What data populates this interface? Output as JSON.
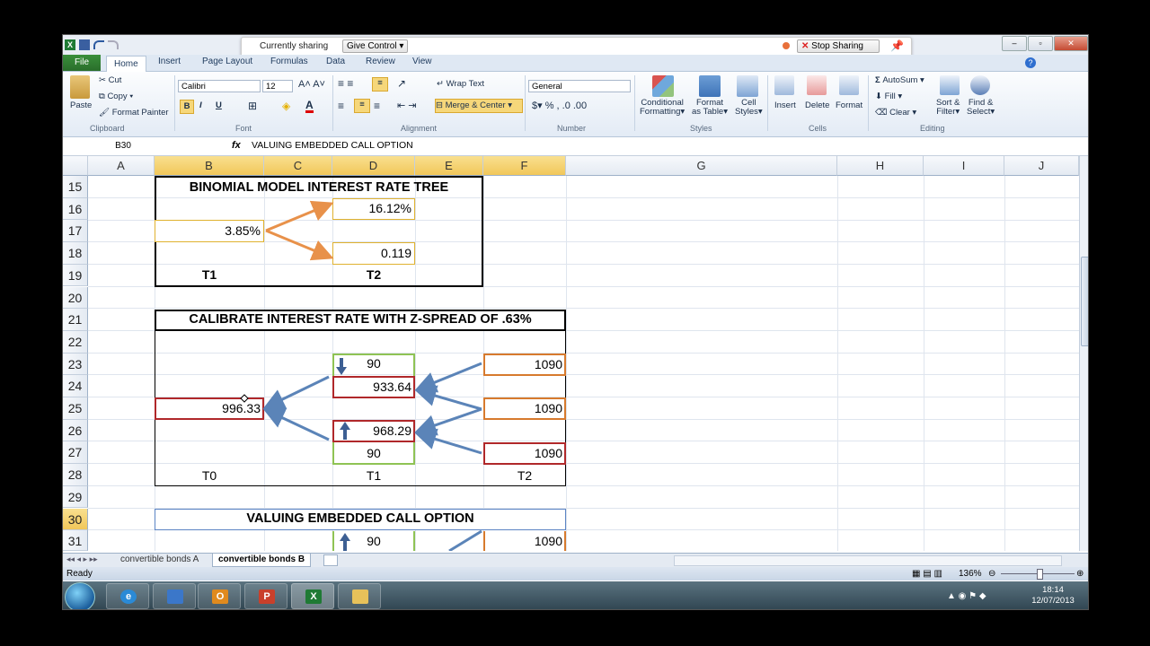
{
  "share_bar": {
    "status": "Currently sharing",
    "give_control": "Give Control",
    "stop": "Stop Sharing"
  },
  "tabs": [
    "File",
    "Home",
    "Insert",
    "Page Layout",
    "Formulas",
    "Data",
    "Review",
    "View"
  ],
  "ribbon": {
    "clipboard": {
      "paste": "Paste",
      "cut": "Cut",
      "copy": "Copy",
      "format_painter": "Format Painter",
      "label": "Clipboard"
    },
    "font": {
      "name": "Calibri",
      "size": "12",
      "label": "Font"
    },
    "alignment": {
      "wrap": "Wrap Text",
      "merge": "Merge & Center",
      "label": "Alignment"
    },
    "number": {
      "format": "General",
      "label": "Number"
    },
    "styles": {
      "cond": "Conditional",
      "cond2": "Formatting",
      "table": "Format",
      "table2": "as Table",
      "cell": "Cell",
      "cell2": "Styles",
      "label": "Styles"
    },
    "cells": {
      "insert": "Insert",
      "delete": "Delete",
      "format": "Format",
      "label": "Cells"
    },
    "editing": {
      "autosum": "AutoSum",
      "fill": "Fill",
      "clear": "Clear",
      "sort": "Sort &",
      "sort2": "Filter",
      "find": "Find &",
      "find2": "Select",
      "label": "Editing"
    }
  },
  "formula_bar": {
    "name_box": "B30",
    "value": "VALUING EMBEDDED CALL OPTION"
  },
  "columns": [
    "A",
    "B",
    "C",
    "D",
    "E",
    "F",
    "G",
    "H",
    "I",
    "J"
  ],
  "rows": [
    "15",
    "16",
    "17",
    "18",
    "19",
    "20",
    "21",
    "22",
    "23",
    "24",
    "25",
    "26",
    "27",
    "28",
    "29",
    "30",
    "31"
  ],
  "tree1": {
    "title": "BINOMIAL MODEL INTEREST RATE TREE",
    "t0": "3.85%",
    "up": "16.12%",
    "down": "0.119",
    "l1": "T1",
    "l2": "T2"
  },
  "tree2": {
    "title": "CALIBRATE INTEREST RATE WITH Z-SPREAD OF .63%",
    "coupon_up": "90",
    "val_up": "933.64",
    "val_down": "968.29",
    "coupon_down": "90",
    "root": "996.33",
    "f1": "1090",
    "f2": "1090",
    "f3": "1090",
    "l0": "T0",
    "l1": "T1",
    "l2": "T2"
  },
  "tree3": {
    "title": "VALUING EMBEDDED CALL OPTION",
    "coupon": "90",
    "f1": "1090"
  },
  "sheet_tabs": [
    "convertible bonds A",
    "convertible bonds B"
  ],
  "status": {
    "ready": "Ready",
    "zoom": "136%"
  },
  "clock": {
    "time": "18:14",
    "date": "12/07/2013"
  }
}
